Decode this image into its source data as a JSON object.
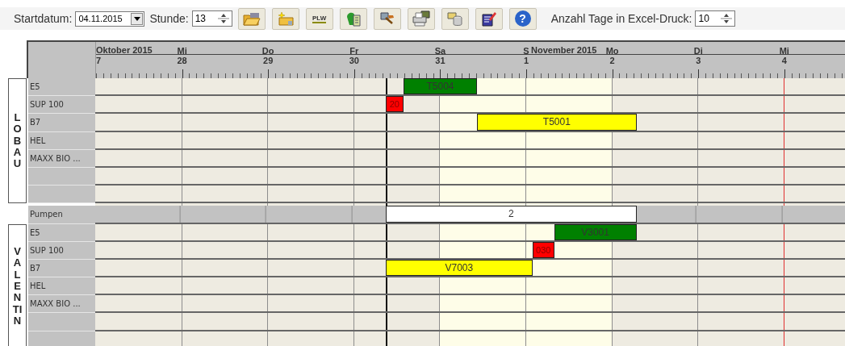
{
  "toolbar": {
    "start_date": {
      "label": "Startdatum:",
      "value": "04.11.2015"
    },
    "hour": {
      "label": "Stunde:",
      "value": "13"
    },
    "buttons": [
      {
        "kind": "icon"
      },
      {
        "kind": "icon"
      },
      {
        "kind": "text",
        "label": "PLW"
      },
      {
        "kind": "icon"
      },
      {
        "kind": "icon"
      },
      {
        "kind": "icon"
      },
      {
        "kind": "icon"
      },
      {
        "kind": "icon"
      },
      {
        "kind": "glyph",
        "label": "?"
      }
    ],
    "excel_days": {
      "label": "Anzahl Tage in Excel-Druck:",
      "value": "10"
    }
  },
  "timeline": {
    "months": [
      {
        "label": "Oktober 2015"
      },
      {
        "label": "November 2015"
      }
    ],
    "days": [
      {
        "date": "7",
        "highlight": false
      },
      {
        "weekday": "Mi",
        "date": "28",
        "highlight": false
      },
      {
        "weekday": "Do",
        "date": "29",
        "highlight": false
      },
      {
        "weekday": "Fr",
        "date": "30",
        "highlight": false
      },
      {
        "weekday": "Sa",
        "date": "31",
        "highlight": true
      },
      {
        "weekday": "S",
        "date": "1",
        "highlight": true
      },
      {
        "weekday": "Mo",
        "date": "2",
        "highlight": false
      },
      {
        "weekday": "Di",
        "date": "3",
        "highlight": false
      },
      {
        "weekday": "Mi",
        "date": "4",
        "highlight": false
      }
    ],
    "markers": [
      {
        "kind": "now"
      },
      {
        "kind": "print_start"
      }
    ]
  },
  "sections": [
    {
      "kind": "group",
      "label": "LOBAU",
      "rows": [
        {
          "name": "E5",
          "bars": [
            {
              "label": "T5004",
              "color": "#008000"
            }
          ]
        },
        {
          "name": "SUP 100",
          "bars": [
            {
              "label": "20",
              "color": "#ff0000"
            }
          ]
        },
        {
          "name": "B7",
          "bars": [
            {
              "label": "T5001",
              "color": "#ffff00"
            }
          ]
        },
        {
          "name": "HEL",
          "bars": []
        },
        {
          "name": "MAXX BIO ...",
          "bars": []
        },
        {
          "bars": []
        },
        {
          "bars": []
        }
      ]
    },
    {
      "kind": "pump",
      "rows": [
        {
          "name": "Pumpen",
          "bars": [
            {
              "label": "2",
              "color": "#ffffff"
            }
          ]
        }
      ]
    },
    {
      "kind": "group",
      "label": "VALENTIN",
      "rows": [
        {
          "name": "E5",
          "bars": [
            {
              "label": "V3001",
              "color": "#008000"
            }
          ]
        },
        {
          "name": "SUP 100",
          "bars": [
            {
              "label": "030",
              "color": "#ff0000"
            }
          ]
        },
        {
          "name": "B7",
          "bars": [
            {
              "label": "V7003",
              "color": "#ffff00"
            }
          ]
        },
        {
          "name": "HEL",
          "bars": []
        },
        {
          "name": "MAXX BIO ...",
          "bars": []
        },
        {
          "bars": []
        },
        {
          "bars": []
        }
      ]
    }
  ]
}
